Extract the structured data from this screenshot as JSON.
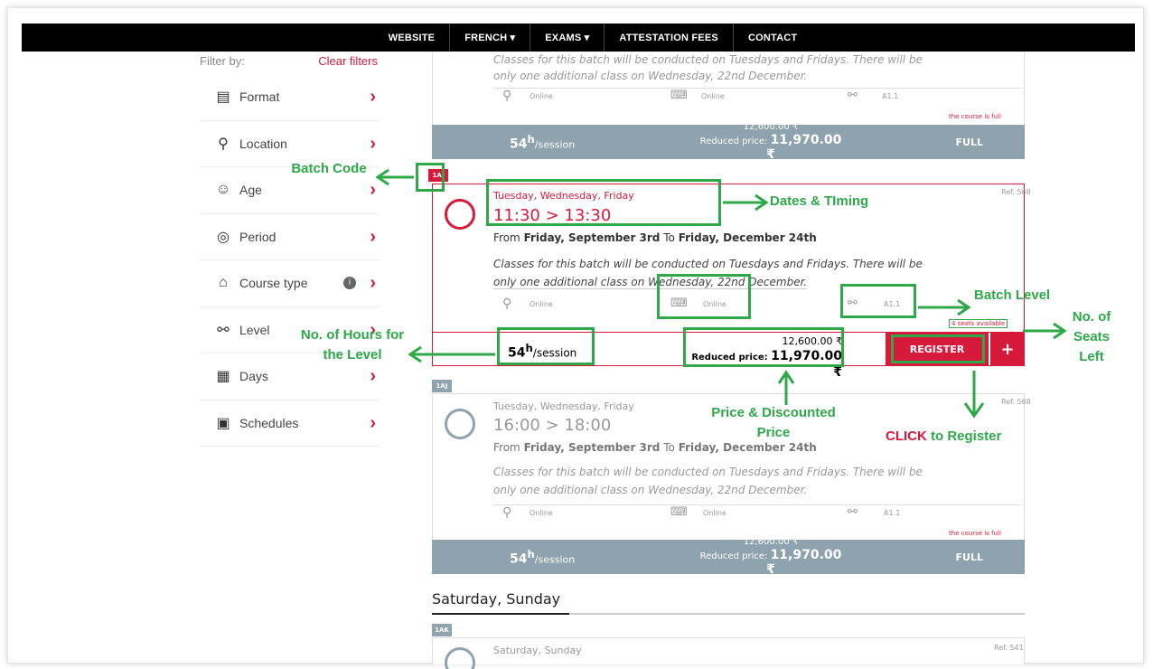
{
  "nav": [
    "WEBSITE",
    "FRENCH",
    "EXAMS",
    "ATTESTATION FEES",
    "CONTACT"
  ],
  "filter": {
    "by": "Filter by:",
    "clear": "Clear filters",
    "items": [
      {
        "label": "Format",
        "icon": "format-icon"
      },
      {
        "label": "Location",
        "icon": "location-pin-icon"
      },
      {
        "label": "Age",
        "icon": "person-icon"
      },
      {
        "label": "Period",
        "icon": "period-icon"
      },
      {
        "label": "Course type",
        "icon": "graduation-cap-icon"
      },
      {
        "label": "Level",
        "icon": "level-icon"
      },
      {
        "label": "Days",
        "icon": "calendar-icon"
      },
      {
        "label": "Schedules",
        "icon": "schedule-icon"
      }
    ]
  },
  "card0": {
    "note1": "Classes for this batch will be conducted on Tuesdays and Fridays. There will be",
    "note2": "only one additional class on Wednesday, 22nd December.",
    "loc": "Online",
    "format": "Online",
    "level": "A1.1",
    "full_note": "the course is full",
    "hours": "54",
    "unit": "/session",
    "price": "12,600.00 ₹",
    "reduced_label": "Reduced price:",
    "reduced": "11,970.00 ₹",
    "status": "FULL"
  },
  "card1": {
    "code": "1AI",
    "ref": "Ref. 568",
    "days": "Tuesday, Wednesday, Friday",
    "time": "11:30 > 13:30",
    "from_prefix": "From",
    "from_date": "Friday, September 3rd",
    "to_prefix": "To",
    "to_date": "Friday, December 24th",
    "note1": "Classes for this batch will be conducted on Tuesdays and Fridays. There will be",
    "note2": "only one additional class on Wednesday, 22nd December.",
    "loc": "Online",
    "format": "Online",
    "level": "A1.1",
    "seats": "4 seats available",
    "hours": "54",
    "unit": "/session",
    "price": "12,600.00 ₹",
    "reduced_label": "Reduced price:",
    "reduced": "11,970.00 ₹",
    "register": "REGISTER",
    "plus": "+"
  },
  "card2": {
    "code": "1AJ",
    "ref": "Ref. 568",
    "days": "Tuesday, Wednesday, Friday",
    "time": "16:00 > 18:00",
    "from_prefix": "From",
    "from_date": "Friday, September 3rd",
    "to_prefix": "To",
    "to_date": "Friday, December 24th",
    "note1": "Classes for this batch will be conducted on Tuesdays and Fridays. There will be",
    "note2": "only one additional class on Wednesday, 22nd December.",
    "loc": "Online",
    "format": "Online",
    "level": "A1.1",
    "full_note": "the course is full",
    "hours": "54",
    "unit": "/session",
    "price": "12,600.00 ₹",
    "reduced_label": "Reduced price:",
    "reduced": "11,970.00 ₹",
    "status": "FULL"
  },
  "section": "Saturday, Sunday",
  "card3": {
    "code": "1AK",
    "days": "Saturday, Sunday",
    "ref": "Ref. 541"
  },
  "annot": {
    "batch_code": "Batch Code",
    "dates": "Dates & TIming",
    "batch_level": "Batch Level",
    "seats_left": "No. of Seats Left",
    "hours": "No. of Hours for the Level",
    "price": "Price & Discounted Price",
    "click": "CLICK",
    "to_register": "to Register"
  },
  "colors": {
    "brand": "#d71a3b",
    "annotation": "#2fa84a",
    "bar": "#8ea3ad"
  }
}
